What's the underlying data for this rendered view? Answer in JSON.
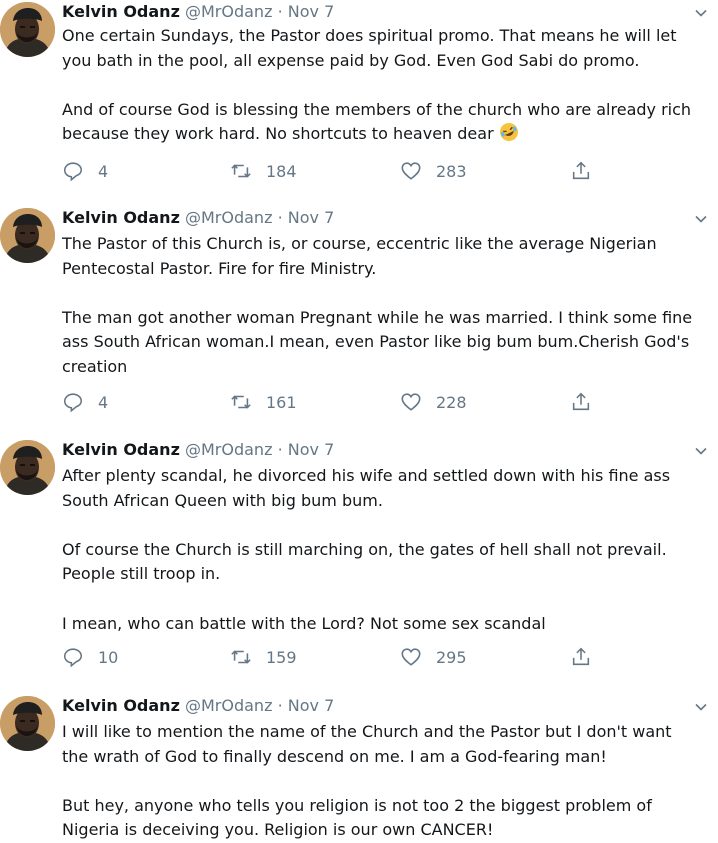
{
  "tweets": [
    {
      "name": "Kelvin Odanz",
      "handle": "@MrOdanz",
      "separator": "·",
      "date": "Nov 7",
      "text": "One certain Sundays, the Pastor does spiritual promo. That means he will let\nyou bath in the pool, all expense paid by God. Even God Sabi do promo.\n\nAnd of course God is blessing the members of the church who are already rich\nbecause they work hard. No shortcuts to heaven dear",
      "emoji": "rofl-emoji",
      "replies": "4",
      "retweets": "184",
      "likes": "283"
    },
    {
      "name": "Kelvin Odanz",
      "handle": "@MrOdanz",
      "separator": "·",
      "date": "Nov 7",
      "text": "The Pastor of this Church is, or course, eccentric like the average Nigerian\nPentecostal Pastor. Fire for fire Ministry.\n\nThe man got another woman Pregnant while he was married. I think some fine\nass South African woman.I mean, even Pastor like big bum bum.Cherish God's\ncreation",
      "replies": "4",
      "retweets": "161",
      "likes": "228"
    },
    {
      "name": "Kelvin Odanz",
      "handle": "@MrOdanz",
      "separator": "·",
      "date": "Nov 7",
      "text": "After plenty scandal, he divorced his wife and settled down with his fine ass\nSouth African Queen with big bum bum.\n\nOf course the Church is still marching on, the gates of hell shall not prevail.\nPeople still troop in.\n\nI mean, who can battle with the Lord? Not some sex scandal",
      "replies": "10",
      "retweets": "159",
      "likes": "295"
    },
    {
      "name": "Kelvin Odanz",
      "handle": "@MrOdanz",
      "separator": "·",
      "date": "Nov 7",
      "text": "I will like to mention the name of the Church and the Pastor but I don't want\nthe wrath of God to finally descend on me. I am a God-fearing man!\n\nBut hey, anyone who tells you religion is not too 2 the biggest problem of\nNigeria is deceiving you. Religion is our own CANCER!"
    }
  ],
  "colors": {
    "text": "#14171a",
    "muted": "#657786",
    "thread_line": "#ccd6dd",
    "emoji": "#f6c33c"
  }
}
